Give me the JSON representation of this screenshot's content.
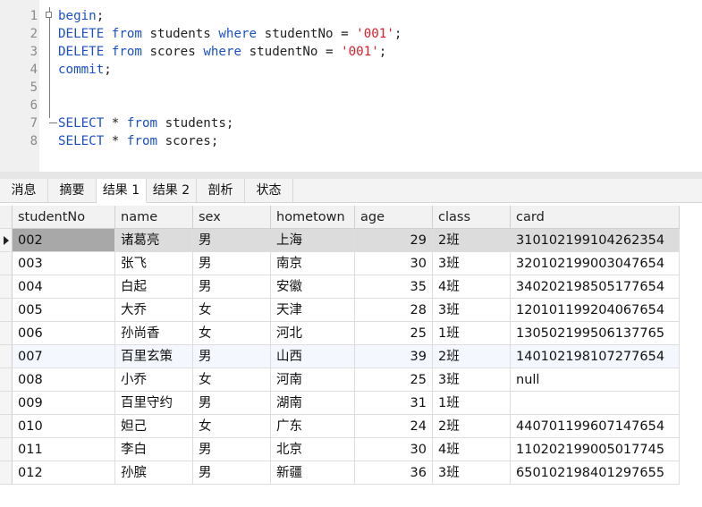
{
  "editor": {
    "lines": [
      {
        "num": "1",
        "tokens": [
          {
            "t": "begin",
            "c": "kw"
          },
          {
            "t": ";",
            "c": ""
          }
        ]
      },
      {
        "num": "2",
        "tokens": [
          {
            "t": "DELETE",
            "c": "kw"
          },
          {
            "t": " ",
            "c": ""
          },
          {
            "t": "from",
            "c": "kw"
          },
          {
            "t": " students ",
            "c": ""
          },
          {
            "t": "where",
            "c": "kw"
          },
          {
            "t": " studentNo = ",
            "c": ""
          },
          {
            "t": "'001'",
            "c": "str"
          },
          {
            "t": ";",
            "c": ""
          }
        ]
      },
      {
        "num": "3",
        "tokens": [
          {
            "t": "DELETE",
            "c": "kw"
          },
          {
            "t": " ",
            "c": ""
          },
          {
            "t": "from",
            "c": "kw"
          },
          {
            "t": " scores ",
            "c": ""
          },
          {
            "t": "where",
            "c": "kw"
          },
          {
            "t": " studentNo = ",
            "c": ""
          },
          {
            "t": "'001'",
            "c": "str"
          },
          {
            "t": ";",
            "c": ""
          }
        ]
      },
      {
        "num": "4",
        "tokens": [
          {
            "t": "commit",
            "c": "kw"
          },
          {
            "t": ";",
            "c": ""
          }
        ]
      },
      {
        "num": "5",
        "tokens": []
      },
      {
        "num": "6",
        "tokens": []
      },
      {
        "num": "7",
        "tokens": [
          {
            "t": "SELECT",
            "c": "kw"
          },
          {
            "t": " * ",
            "c": ""
          },
          {
            "t": "from",
            "c": "kw"
          },
          {
            "t": " students;",
            "c": ""
          }
        ]
      },
      {
        "num": "8",
        "tokens": [
          {
            "t": "SELECT",
            "c": "kw"
          },
          {
            "t": " * ",
            "c": ""
          },
          {
            "t": "from",
            "c": "kw"
          },
          {
            "t": " scores;",
            "c": ""
          }
        ]
      }
    ]
  },
  "tabs": [
    "消息",
    "摘要",
    "结果 1",
    "结果 2",
    "剖析",
    "状态"
  ],
  "active_tab": "结果 1",
  "grid": {
    "columns": [
      "studentNo",
      "name",
      "sex",
      "hometown",
      "age",
      "class",
      "card"
    ],
    "rows": [
      [
        "002",
        "诸葛亮",
        "男",
        "上海",
        "29",
        "2班",
        "310102199104262354"
      ],
      [
        "003",
        "张飞",
        "男",
        "南京",
        "30",
        "3班",
        "320102199003047654"
      ],
      [
        "004",
        "白起",
        "男",
        "安徽",
        "35",
        "4班",
        "340202198505177654"
      ],
      [
        "005",
        "大乔",
        "女",
        "天津",
        "28",
        "3班",
        "120101199204067654"
      ],
      [
        "006",
        "孙尚香",
        "女",
        "河北",
        "25",
        "1班",
        "130502199506137765"
      ],
      [
        "007",
        "百里玄策",
        "男",
        "山西",
        "39",
        "2班",
        "140102198107277654"
      ],
      [
        "008",
        "小乔",
        "女",
        "河南",
        "25",
        "3班",
        "null"
      ],
      [
        "009",
        "百里守约",
        "男",
        "湖南",
        "31",
        "1班",
        ""
      ],
      [
        "010",
        "妲己",
        "女",
        "广东",
        "24",
        "2班",
        "440701199607147654"
      ],
      [
        "011",
        "李白",
        "男",
        "北京",
        "30",
        "4班",
        "110202199005017745"
      ],
      [
        "012",
        "孙膑",
        "男",
        "新疆",
        "36",
        "3班",
        "650102198401297655"
      ]
    ]
  },
  "colors": {
    "keyword": "#1c50c8",
    "string": "#d8202a",
    "selected_row": "#dcdcdc"
  }
}
